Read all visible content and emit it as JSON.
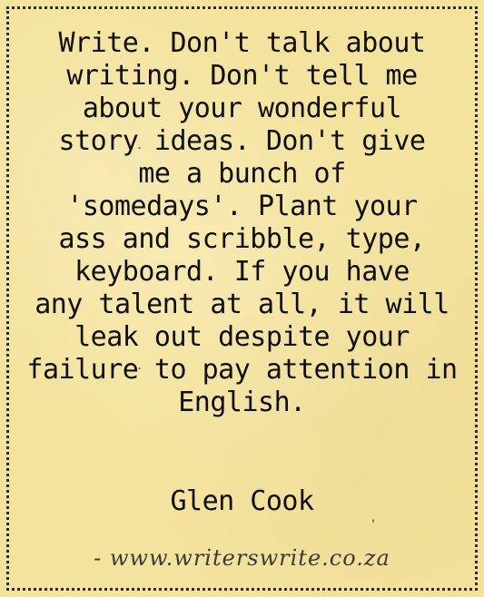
{
  "quote": {
    "text": "Write. Don't talk about\nwriting. Don't tell me\nabout your wonderful\nstory ideas. Don't give\nme a bunch of\n'somedays'. Plant your\nass and scribble, type,\nkeyboard. If you have\nany talent at all, it will\nleak out despite your\nfailure to pay attention in\nEnglish."
  },
  "author": {
    "name": "Glen Cook"
  },
  "footer": {
    "website": "- www.writerswrite.co.za"
  },
  "colors": {
    "background": "#f4e39d",
    "text": "#0f0f0f",
    "frame": "#2b2b2b"
  }
}
